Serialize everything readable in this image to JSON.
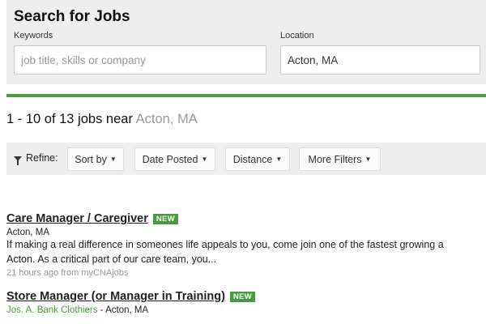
{
  "search": {
    "title": "Search for Jobs",
    "keywords_label": "Keywords",
    "keywords_placeholder": "job title, skills or company",
    "keywords_value": "",
    "location_label": "Location",
    "location_value": "Acton, MA"
  },
  "results": {
    "range": "1 - 10 of 13",
    "jobs_near": "jobs near",
    "location": "Acton, MA"
  },
  "refine": {
    "label": "Refine:",
    "filters": [
      {
        "label": "Sort by"
      },
      {
        "label": "Date Posted"
      },
      {
        "label": "Distance"
      },
      {
        "label": "More Filters"
      }
    ]
  },
  "jobs": [
    {
      "title": "Care Manager / Caregiver",
      "badge": "NEW",
      "location": "Acton, MA",
      "description_line1": "If making a real difference in someones life appeals to you, come join one of the fastest growing a",
      "description_line2": "Acton. As a critical part of our care team, you...",
      "age": "21 hours ago from myCNAjobs"
    },
    {
      "title": "Store Manager (or Manager in Training)",
      "badge": "NEW",
      "company": "Jos. A. Bank Clothiers",
      "separator": " - ",
      "location": "Acton, MA"
    }
  ],
  "colors": {
    "accent_green": "#4a9b3f",
    "panel_gray": "#eeeeee",
    "muted_text": "#999999"
  }
}
